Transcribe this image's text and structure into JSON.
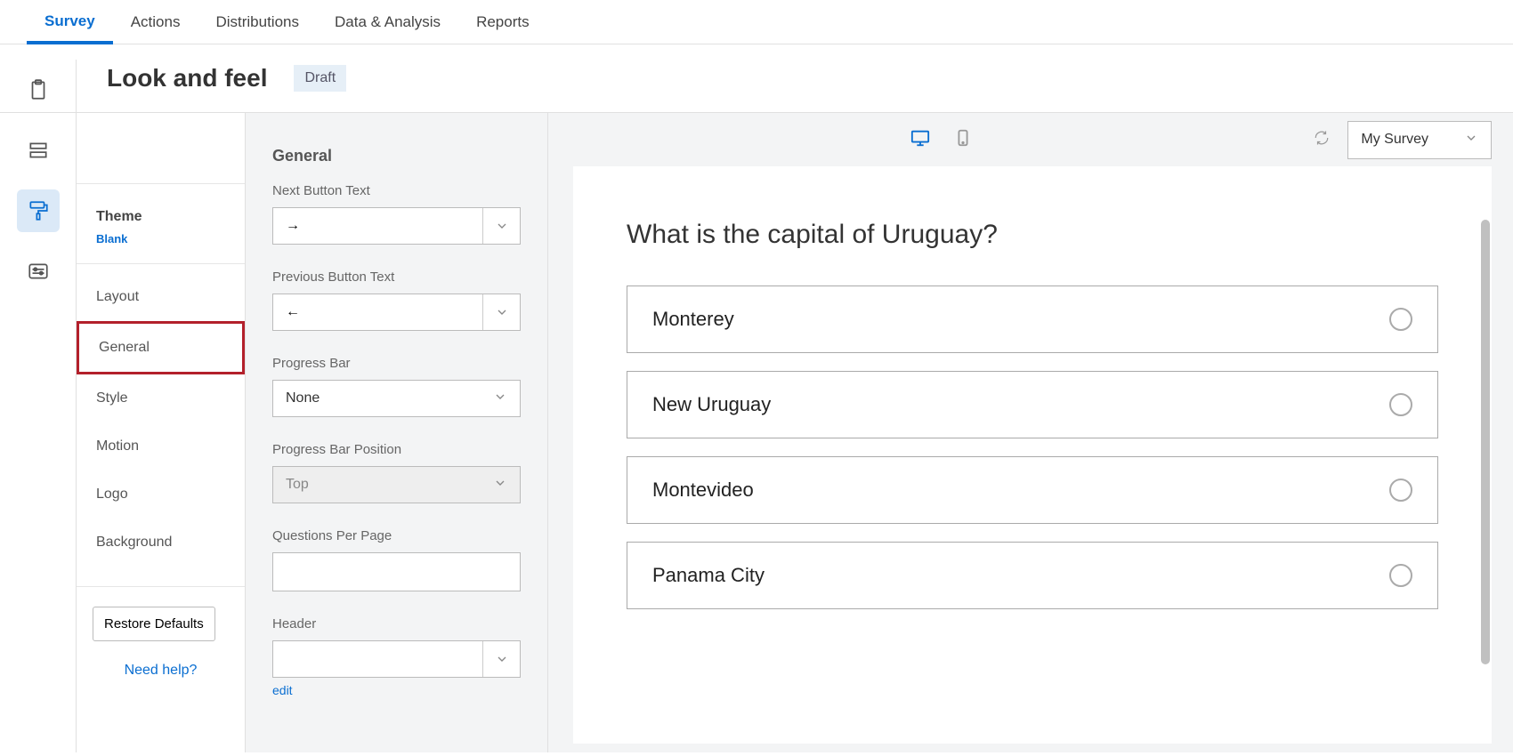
{
  "nav": {
    "tabs": [
      "Survey",
      "Actions",
      "Distributions",
      "Data & Analysis",
      "Reports"
    ],
    "active": 0
  },
  "page": {
    "title": "Look and feel",
    "badge": "Draft"
  },
  "sidebar": {
    "theme_label": "Theme",
    "theme_name": "Blank",
    "items": [
      "Layout",
      "General",
      "Style",
      "Motion",
      "Logo",
      "Background"
    ],
    "highlight_index": 1,
    "restore": "Restore Defaults",
    "need_help": "Need help?"
  },
  "settings": {
    "heading": "General",
    "next_btn": {
      "label": "Next Button Text",
      "value": "→"
    },
    "prev_btn": {
      "label": "Previous Button Text",
      "value": "←"
    },
    "progress_bar": {
      "label": "Progress Bar",
      "value": "None"
    },
    "progress_pos": {
      "label": "Progress Bar Position",
      "value": "Top"
    },
    "per_page": {
      "label": "Questions Per Page",
      "value": ""
    },
    "header": {
      "label": "Header",
      "value": "",
      "edit": "edit"
    }
  },
  "preview": {
    "survey_select": "My Survey",
    "question": "What is the capital of Uruguay?",
    "choices": [
      "Monterey",
      "New Uruguay",
      "Montevideo",
      "Panama City"
    ]
  }
}
